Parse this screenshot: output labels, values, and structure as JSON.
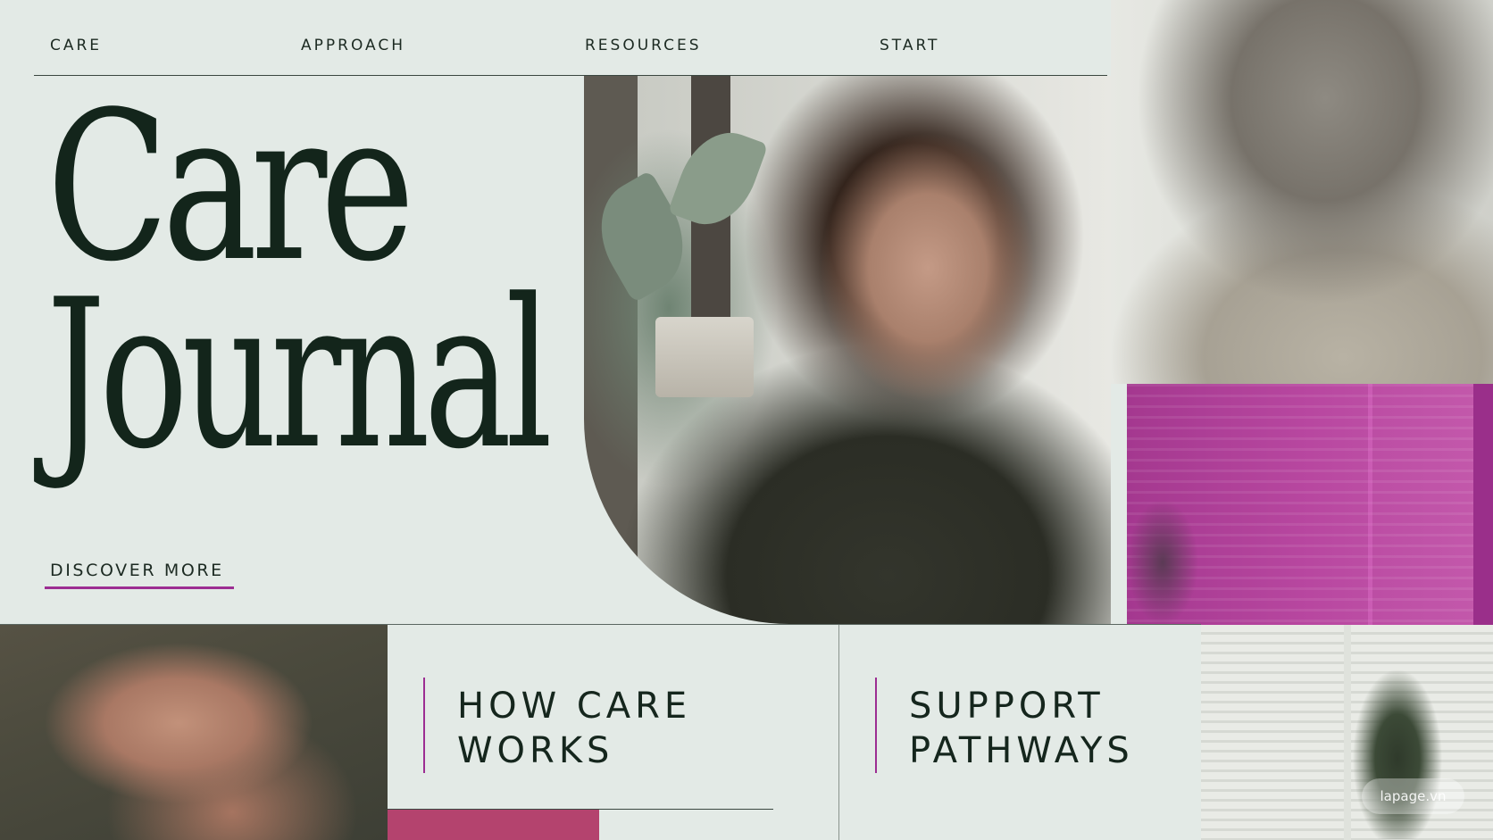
{
  "nav": {
    "items": [
      {
        "label": "CARE"
      },
      {
        "label": "APPROACH"
      },
      {
        "label": "RESOURCES"
      },
      {
        "label": "START"
      }
    ]
  },
  "hero": {
    "title_line_1": "Care",
    "title_line_2": "Journal",
    "cta_label": "DISCOVER MORE"
  },
  "cards": [
    {
      "title_line_1": "HOW CARE",
      "title_line_2": "WORKS"
    },
    {
      "title_line_1": "SUPPORT",
      "title_line_2": "PATHWAYS"
    }
  ],
  "watermark": "lapage.vn",
  "colors": {
    "background": "#e3eae6",
    "text": "#13251b",
    "accent_purple": "#9c2d92",
    "magenta_panel": "#b847a0",
    "rose_block": "#b4436e"
  },
  "images": {
    "main": "woman-listening-photo",
    "right": "older-woman-back-photo",
    "magenta": "magenta-window-shadow-photo",
    "hands": "holding-hands-photo",
    "window": "window-plant-photo"
  }
}
